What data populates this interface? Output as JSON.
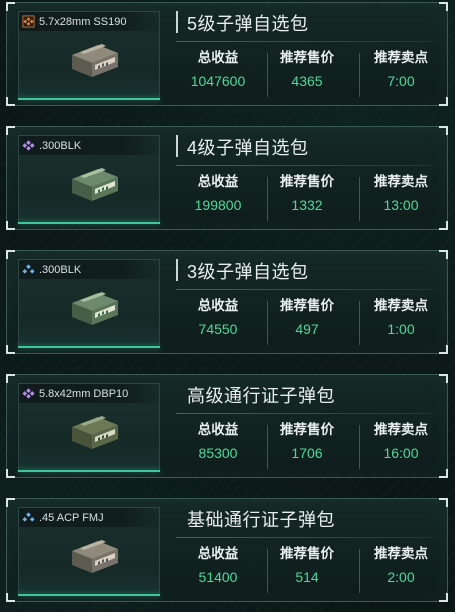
{
  "colors": {
    "value_green": "#4fd99a",
    "accent_line": "#3fc79a",
    "rarity_orange": "#e8893a",
    "rarity_purple": "#b98cf0",
    "rarity_blue": "#6fb3ea"
  },
  "labels": {
    "total_income": "总收益",
    "suggested_price": "推荐售价",
    "suggested_time": "推荐卖点"
  },
  "packs": [
    {
      "caliber": "5.7x28mm SS190",
      "rarity_icon": "orange-diamond-icon",
      "rarity_color": "#e8893a",
      "title": "5级子弹自选包",
      "total_income": "1047600",
      "suggested_price": "4365",
      "suggested_time": "7:00"
    },
    {
      "caliber": ".300BLK",
      "rarity_icon": "purple-diamond-icon",
      "rarity_color": "#b98cf0",
      "title": "4级子弹自选包",
      "total_income": "199800",
      "suggested_price": "1332",
      "suggested_time": "13:00"
    },
    {
      "caliber": ".300BLK",
      "rarity_icon": "blue-diamond-icon",
      "rarity_color": "#6fb3ea",
      "title": "3级子弹自选包",
      "total_income": "74550",
      "suggested_price": "497",
      "suggested_time": "1:00"
    },
    {
      "caliber": "5.8x42mm DBP10",
      "rarity_icon": "purple-diamond-icon",
      "rarity_color": "#b98cf0",
      "title": "高级通行证子弹包",
      "total_income": "85300",
      "suggested_price": "1706",
      "suggested_time": "16:00"
    },
    {
      "caliber": ".45 ACP FMJ",
      "rarity_icon": "blue-diamond-icon",
      "rarity_color": "#6fb3ea",
      "title": "基础通行证子弹包",
      "total_income": "51400",
      "suggested_price": "514",
      "suggested_time": "2:00"
    }
  ]
}
